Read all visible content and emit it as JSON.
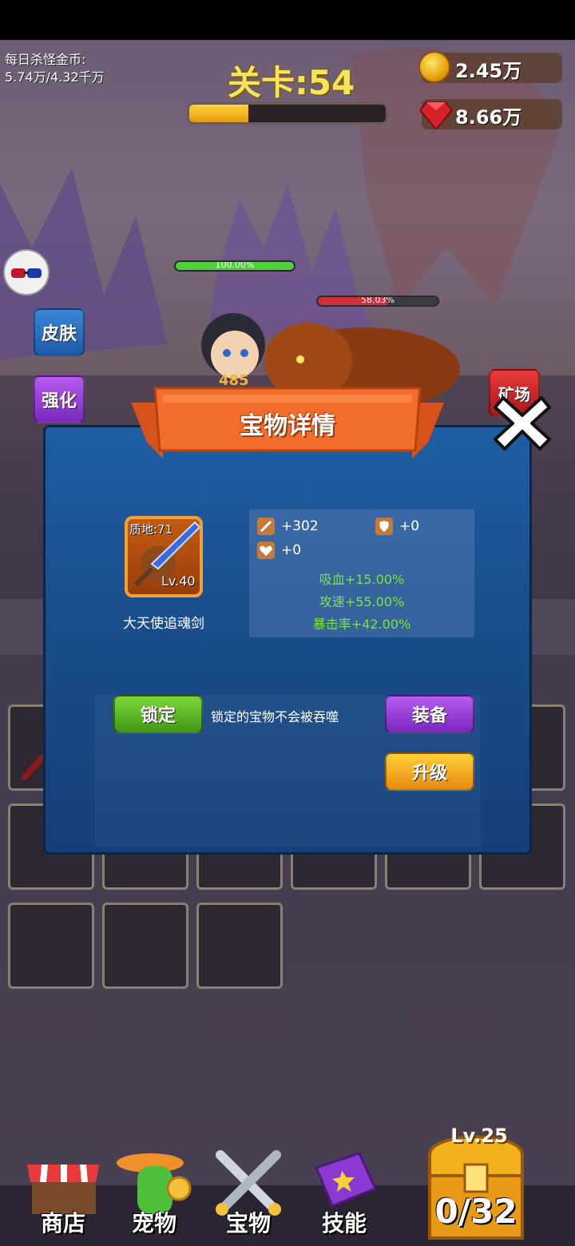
{
  "hud": {
    "kill_gold_label": "每日杀怪金币:",
    "kill_gold_value": "5.74万/4.32千万",
    "level_title": "关卡:54",
    "level_progress": 0.3,
    "gold": "2.45万",
    "gems": "8.66万"
  },
  "side_buttons": {
    "skin": "皮肤",
    "enhance": "强化",
    "mine": "矿场"
  },
  "battle": {
    "hero_hp": "100.00%",
    "hero_hp_fraction": 1.0,
    "enemy_hp": "58.03%",
    "enemy_hp_fraction": 0.58,
    "damage_text": "485"
  },
  "modal": {
    "title": "宝物详情",
    "item": {
      "quality": "质地:71",
      "level": "Lv.40",
      "name": "大天使追魂剑"
    },
    "stats": {
      "attack": "+302",
      "defense": "+0",
      "hp": "+0"
    },
    "bonuses": [
      "吸血+15.00%",
      "攻速+55.00%",
      "暴击率+42.00%"
    ],
    "lock_label": "锁定",
    "lock_hint": "锁定的宝物不会被吞噬",
    "equip_label": "装备",
    "upgrade_label": "升级"
  },
  "nav": {
    "shop": "商店",
    "pet": "宠物",
    "treasure": "宝物",
    "skill": "技能",
    "chest_level": "Lv.25",
    "chest_count": "0/32"
  },
  "colors": {
    "modal_blue": "#1a4f8e",
    "banner_orange": "#f0702a",
    "lock_green": "#4fae1e",
    "equip_purple": "#8e38d0",
    "upgrade_orange": "#f4a51e",
    "bonus_green": "#7ce14a"
  },
  "icons": [
    "coin-icon",
    "gem-icon",
    "close-icon",
    "sword-icon",
    "shield-icon",
    "heart-icon"
  ]
}
